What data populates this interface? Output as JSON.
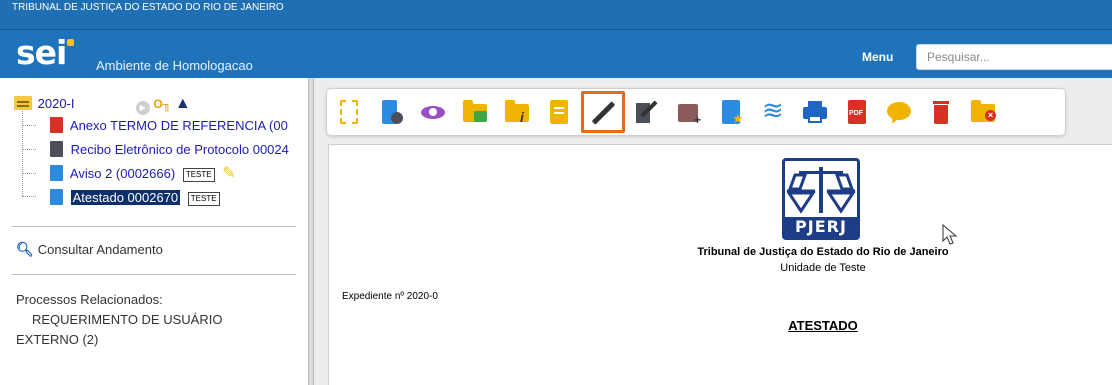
{
  "header": {
    "org_title": "TRIBUNAL DE JUSTIÇA DO ESTADO DO RIO DE JANEIRO",
    "logo_text": "sei",
    "environment": "Ambiente de Homologacao",
    "menu_label": "Menu",
    "search_placeholder": "Pesquisar..."
  },
  "tree": {
    "process_number": "2020-I",
    "documents": [
      {
        "label": "Anexo TERMO DE REFERENCIA (00",
        "type": "pdf-icon"
      },
      {
        "label": "Recibo Eletrônico de Protocolo 00024",
        "type": "receipt-icon"
      },
      {
        "label": "Aviso 2 (0002666)",
        "type": "document-icon",
        "tag": "TESTE"
      },
      {
        "label": "Atestado 0002670",
        "type": "document-icon",
        "tag": "TESTE",
        "selected": true
      }
    ]
  },
  "sidebar": {
    "consult_label": "Consultar Andamento",
    "related_title": "Processos Relacionados:",
    "related_item_line1": "REQUERIMENTO DE USUÁRIO",
    "related_item_line2": "EXTERNO (2)"
  },
  "toolbar": {
    "buttons": [
      "new-document-icon",
      "process-settings-icon",
      "view-icon",
      "send-folder-icon",
      "folder-info-icon",
      "edit-document-icon",
      "sign-pen-icon",
      "sign-block-icon",
      "add-block-icon",
      "document-star-icon",
      "layers-icon",
      "print-icon",
      "pdf-icon",
      "comment-icon",
      "delete-icon",
      "close-folder-icon"
    ],
    "active_button": "sign-pen-icon"
  },
  "document": {
    "seal_text": "PJERJ",
    "court_name": "Tribunal de Justiça do Estado do Rio de Janeiro",
    "unit_name": "Unidade de Teste",
    "expediente": "Expediente nº 2020-0",
    "title": "ATESTADO"
  },
  "colors": {
    "header_blue": "#1f73bb",
    "selection_navy": "#0d2f6b",
    "active_orange": "#e36b1c",
    "seal_blue": "#1d3d86"
  }
}
